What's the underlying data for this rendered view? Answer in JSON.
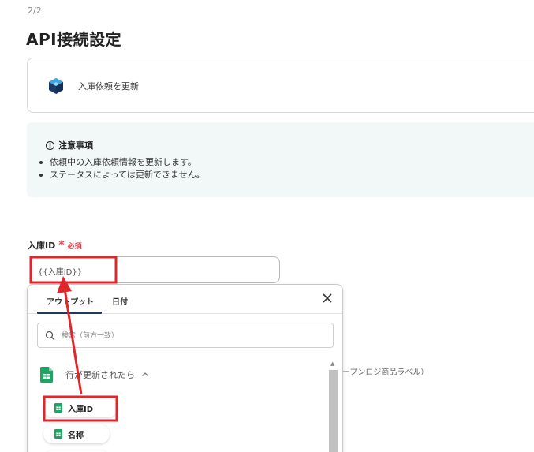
{
  "step": "2/2",
  "page_title": "API接続設定",
  "action": {
    "label": "入庫依頼を更新"
  },
  "notice": {
    "title": "注意事項",
    "items": [
      "依頼中の入庫依頼情報を更新します。",
      "ステータスによっては更新できません。"
    ]
  },
  "field": {
    "label": "入庫ID",
    "required_label": "必須",
    "value": "{{入庫ID}}"
  },
  "hint_text": "ープンロジ商品ラベル）",
  "dropdown": {
    "tabs": [
      "アウトプット",
      "日付"
    ],
    "search_placeholder": "検索（前方一致）",
    "group_title": "行が更新されたら",
    "items": [
      "入庫ID",
      "名称",
      ""
    ]
  },
  "colors": {
    "highlight_red": "#e0262b",
    "sheet_green": "#1fa463",
    "tab_underline": "#1f3a5a",
    "notice_bg": "#f1f8f7"
  }
}
